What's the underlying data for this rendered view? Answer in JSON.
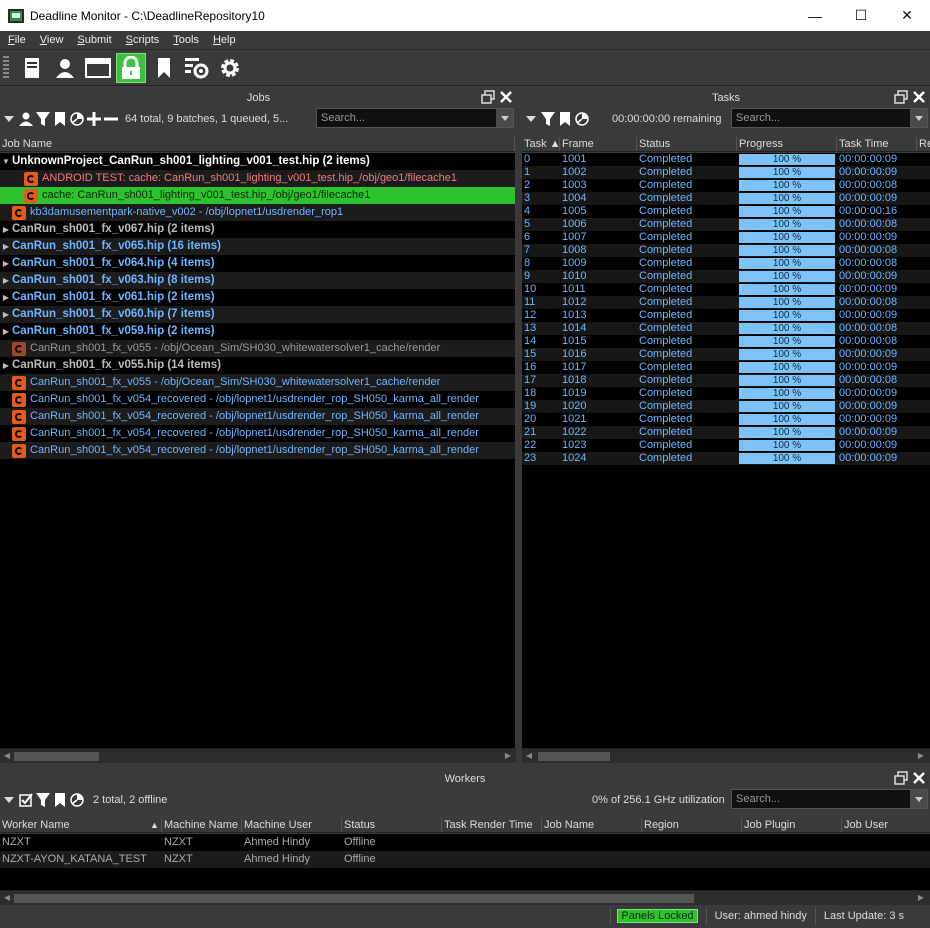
{
  "window": {
    "title": "Deadline Monitor  -  C:\\DeadlineRepository10",
    "minimize": "—",
    "maximize": "☐",
    "close": "✕"
  },
  "menu": [
    "File",
    "View",
    "Submit",
    "Scripts",
    "Tools",
    "Help"
  ],
  "jobs_panel": {
    "title": "Jobs",
    "summary": "64 total, 9 batches, 1 queued, 5...",
    "search_placeholder": "Search...",
    "column_header": "Job Name",
    "rows": [
      {
        "type": "group",
        "text": "UnknownProject_CanRun_sh001_lighting_v001_test.hip (2 items)",
        "expanded": true,
        "color": "#ffffff"
      },
      {
        "type": "job",
        "indent": 2,
        "text": "ANDROID TEST: cache: CanRun_sh001_lighting_v001_test.hip_/obj/geo1/filecache1",
        "color": "#f07b7b"
      },
      {
        "type": "job",
        "indent": 2,
        "text": "cache: CanRun_sh001_lighting_v001_test.hip_/obj/geo1/filecache1",
        "color": "#0a2a0a",
        "selected": true
      },
      {
        "type": "job",
        "indent": 1,
        "text": "kb3damusementpark-native_v002 - /obj/lopnet1/usdrender_rop1",
        "color": "#6fb5ff"
      },
      {
        "type": "group",
        "text": "CanRun_sh001_fx_v067.hip (2 items)",
        "expanded": false,
        "color": "#bbbbbb"
      },
      {
        "type": "group",
        "text": "CanRun_sh001_fx_v065.hip (16 items)",
        "expanded": false,
        "color": "#6fb5ff"
      },
      {
        "type": "group",
        "text": "CanRun_sh001_fx_v064.hip (4 items)",
        "expanded": false,
        "color": "#6fb5ff"
      },
      {
        "type": "group",
        "text": "CanRun_sh001_fx_v063.hip (8 items)",
        "expanded": false,
        "color": "#6fb5ff"
      },
      {
        "type": "group",
        "text": "CanRun_sh001_fx_v061.hip (2 items)",
        "expanded": false,
        "color": "#6fb5ff"
      },
      {
        "type": "group",
        "text": "CanRun_sh001_fx_v060.hip (7 items)",
        "expanded": false,
        "color": "#6fb5ff"
      },
      {
        "type": "group",
        "text": "CanRun_sh001_fx_v059.hip (2 items)",
        "expanded": false,
        "color": "#6fb5ff"
      },
      {
        "type": "job",
        "indent": 1,
        "text": "CanRun_sh001_fx_v055 - /obj/Ocean_Sim/SH030_whitewatersolver1_cache/render",
        "color": "#9a9a9a",
        "gray": true
      },
      {
        "type": "group",
        "text": "CanRun_sh001_fx_v055.hip (14 items)",
        "expanded": false,
        "color": "#bbbbbb"
      },
      {
        "type": "job",
        "indent": 1,
        "text": "CanRun_sh001_fx_v055 - /obj/Ocean_Sim/SH030_whitewatersolver1_cache/render",
        "color": "#6fb5ff"
      },
      {
        "type": "job",
        "indent": 1,
        "text": "CanRun_sh001_fx_v054_recovered - /obj/lopnet1/usdrender_rop_SH050_karma_all_render",
        "color": "#6fb5ff"
      },
      {
        "type": "job",
        "indent": 1,
        "text": "CanRun_sh001_fx_v054_recovered - /obj/lopnet1/usdrender_rop_SH050_karma_all_render",
        "color": "#6fb5ff"
      },
      {
        "type": "job",
        "indent": 1,
        "text": "CanRun_sh001_fx_v054_recovered - /obj/lopnet1/usdrender_rop_SH050_karma_all_render",
        "color": "#6fb5ff"
      },
      {
        "type": "job",
        "indent": 1,
        "text": "CanRun_sh001_fx_v054_recovered - /obj/lopnet1/usdrender_rop_SH050_karma_all_render",
        "color": "#6fb5ff"
      }
    ]
  },
  "tasks_panel": {
    "title": "Tasks",
    "remaining": "00:00:00:00 remaining",
    "search_placeholder": "Search...",
    "columns": [
      "Task ▲",
      "Frame",
      "Status",
      "Progress",
      "Task Time",
      "Re"
    ],
    "rows": [
      {
        "task": "0",
        "frame": "1001",
        "status": "Completed",
        "progress": "100 %",
        "time": "00:00:00:09"
      },
      {
        "task": "1",
        "frame": "1002",
        "status": "Completed",
        "progress": "100 %",
        "time": "00:00:00:09"
      },
      {
        "task": "2",
        "frame": "1003",
        "status": "Completed",
        "progress": "100 %",
        "time": "00:00:00:08"
      },
      {
        "task": "3",
        "frame": "1004",
        "status": "Completed",
        "progress": "100 %",
        "time": "00:00:00:09"
      },
      {
        "task": "4",
        "frame": "1005",
        "status": "Completed",
        "progress": "100 %",
        "time": "00:00:00:16"
      },
      {
        "task": "5",
        "frame": "1006",
        "status": "Completed",
        "progress": "100 %",
        "time": "00:00:00:08"
      },
      {
        "task": "6",
        "frame": "1007",
        "status": "Completed",
        "progress": "100 %",
        "time": "00:00:00:09"
      },
      {
        "task": "7",
        "frame": "1008",
        "status": "Completed",
        "progress": "100 %",
        "time": "00:00:00:08"
      },
      {
        "task": "8",
        "frame": "1009",
        "status": "Completed",
        "progress": "100 %",
        "time": "00:00:00:08"
      },
      {
        "task": "9",
        "frame": "1010",
        "status": "Completed",
        "progress": "100 %",
        "time": "00:00:00:09"
      },
      {
        "task": "10",
        "frame": "1011",
        "status": "Completed",
        "progress": "100 %",
        "time": "00:00:00:09"
      },
      {
        "task": "11",
        "frame": "1012",
        "status": "Completed",
        "progress": "100 %",
        "time": "00:00:00:08"
      },
      {
        "task": "12",
        "frame": "1013",
        "status": "Completed",
        "progress": "100 %",
        "time": "00:00:00:09"
      },
      {
        "task": "13",
        "frame": "1014",
        "status": "Completed",
        "progress": "100 %",
        "time": "00:00:00:08"
      },
      {
        "task": "14",
        "frame": "1015",
        "status": "Completed",
        "progress": "100 %",
        "time": "00:00:00:08"
      },
      {
        "task": "15",
        "frame": "1016",
        "status": "Completed",
        "progress": "100 %",
        "time": "00:00:00:09"
      },
      {
        "task": "16",
        "frame": "1017",
        "status": "Completed",
        "progress": "100 %",
        "time": "00:00:00:09"
      },
      {
        "task": "17",
        "frame": "1018",
        "status": "Completed",
        "progress": "100 %",
        "time": "00:00:00:08"
      },
      {
        "task": "18",
        "frame": "1019",
        "status": "Completed",
        "progress": "100 %",
        "time": "00:00:00:09"
      },
      {
        "task": "19",
        "frame": "1020",
        "status": "Completed",
        "progress": "100 %",
        "time": "00:00:00:09"
      },
      {
        "task": "20",
        "frame": "1021",
        "status": "Completed",
        "progress": "100 %",
        "time": "00:00:00:09"
      },
      {
        "task": "21",
        "frame": "1022",
        "status": "Completed",
        "progress": "100 %",
        "time": "00:00:00:09"
      },
      {
        "task": "22",
        "frame": "1023",
        "status": "Completed",
        "progress": "100 %",
        "time": "00:00:00:09"
      },
      {
        "task": "23",
        "frame": "1024",
        "status": "Completed",
        "progress": "100 %",
        "time": "00:00:00:09"
      }
    ]
  },
  "workers_panel": {
    "title": "Workers",
    "summary": "2 total, 2 offline",
    "utilization": "0% of 256.1 GHz utilization",
    "search_placeholder": "Search...",
    "columns": [
      "Worker Name",
      "▲",
      "Machine Name",
      "Machine User",
      "Status",
      "Task Render Time",
      "Job Name",
      "Region",
      "Job Plugin",
      "Job User"
    ],
    "rows": [
      {
        "worker": "NZXT",
        "machine": "NZXT",
        "user": "Ahmed Hindy",
        "status": "Offline"
      },
      {
        "worker": "NZXT-AYON_KATANA_TEST",
        "machine": "NZXT",
        "user": "Ahmed Hindy",
        "status": "Offline"
      }
    ]
  },
  "statusbar": {
    "panels_locked": "Panels Locked",
    "user": "User: ahmed hindy",
    "last_update": "Last Update: 3 s"
  },
  "colors": {
    "accent_green": "#2ec22e",
    "link_blue": "#6fb5ff",
    "progress_fill": "#7ec3f7"
  }
}
